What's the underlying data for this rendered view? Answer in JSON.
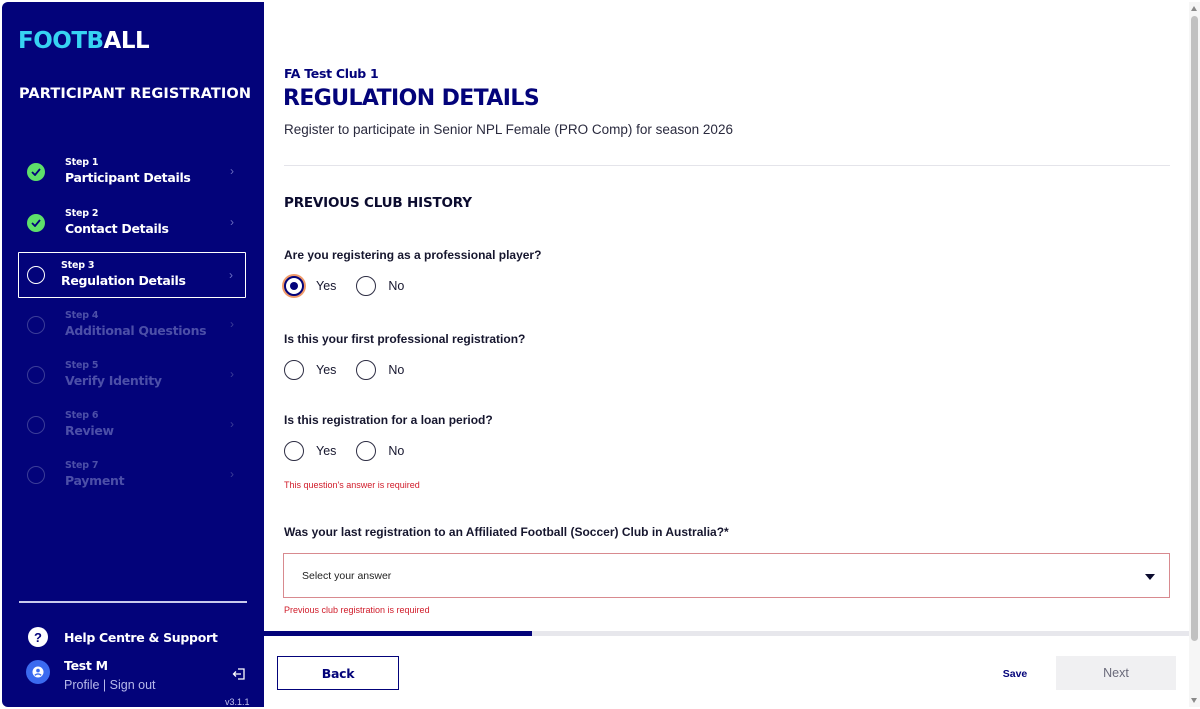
{
  "sidebar": {
    "logo_part1": "FOOTB",
    "logo_part2": "ALL",
    "title": "PARTICIPANT REGISTRATION",
    "steps": [
      {
        "num": "Step 1",
        "label": "Participant Details",
        "state": "done"
      },
      {
        "num": "Step 2",
        "label": "Contact Details",
        "state": "done"
      },
      {
        "num": "Step 3",
        "label": "Regulation Details",
        "state": "current"
      },
      {
        "num": "Step 4",
        "label": "Additional Questions",
        "state": "todo"
      },
      {
        "num": "Step 5",
        "label": "Verify Identity",
        "state": "todo"
      },
      {
        "num": "Step 6",
        "label": "Review",
        "state": "todo"
      },
      {
        "num": "Step 7",
        "label": "Payment",
        "state": "todo"
      }
    ],
    "help_label": "Help Centre & Support",
    "user_name": "Test M",
    "profile_link": "Profile",
    "link_sep": " | ",
    "signout_link": "Sign out",
    "version": "v3.1.1"
  },
  "main": {
    "club": "FA Test Club 1",
    "title": "REGULATION DETAILS",
    "subtitle": "Register to participate in Senior NPL Female (PRO Comp) for season 2026",
    "section": "PREVIOUS CLUB HISTORY",
    "questions": [
      {
        "label": "Are you registering as a professional player?",
        "yes": "Yes",
        "no": "No",
        "selected": "Yes"
      },
      {
        "label": "Is this your first professional registration?",
        "yes": "Yes",
        "no": "No",
        "selected": ""
      },
      {
        "label": "Is this registration for a loan period?",
        "yes": "Yes",
        "no": "No",
        "selected": "",
        "error": "This question's answer is required"
      }
    ],
    "club_question": "Was your last registration to an Affiliated Football (Soccer) Club in Australia?*",
    "select_placeholder": "Select your answer",
    "select_error": "Previous club registration is required",
    "progress": 0.29
  },
  "footer": {
    "back": "Back",
    "save": "Save",
    "next": "Next"
  },
  "colors": {
    "primary": "#03037a",
    "accent": "#37d3f2",
    "done": "#5ee06a",
    "error": "#d01c2a"
  }
}
